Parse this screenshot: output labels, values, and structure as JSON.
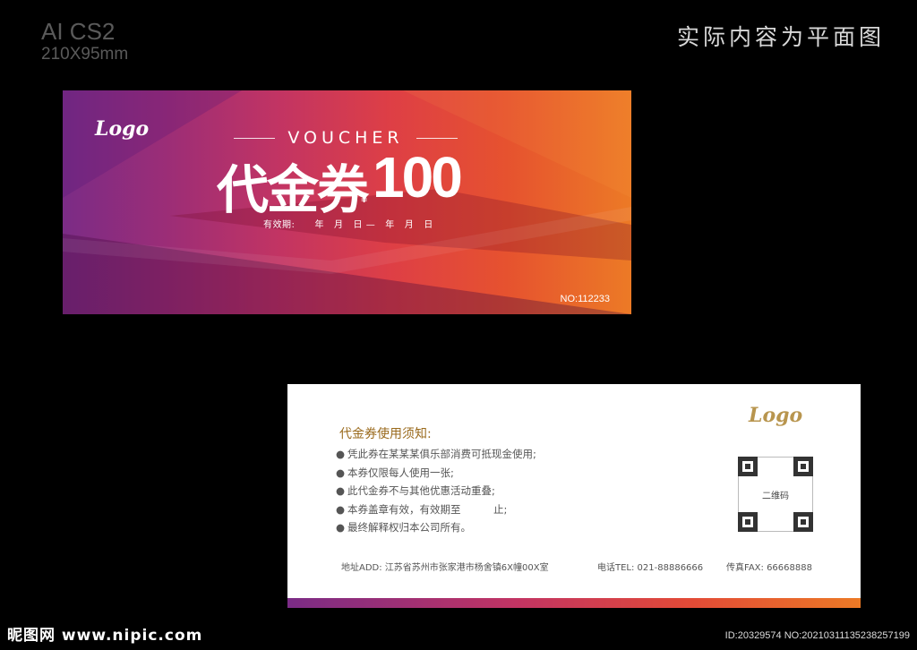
{
  "meta": {
    "software": "AI CS2",
    "size": "210X95mm",
    "note": "实际内容为平面图"
  },
  "front": {
    "logo": "Logo",
    "voucher_word": "VOUCHER",
    "title": "代金券",
    "currency": "¥",
    "amount": "100",
    "validity": "有效期:      年   月   日 —   年   月   日",
    "serial": "NO:112233",
    "colors": {
      "gradient_start": "#7b2c86",
      "gradient_mid": "#de3f45",
      "gradient_end": "#ec7a26"
    }
  },
  "back": {
    "logo": "Logo",
    "notes_title": "代金券使用须知:",
    "notes": [
      "凭此券在某某某俱乐部消费可抵现金使用;",
      "本券仅限每人使用一张;",
      "此代金券不与其他优惠活动重叠;",
      "本券盖章有效，有效期至          止;",
      "最终解释权归本公司所有。"
    ],
    "qr_label": "二维码",
    "address": "地址ADD: 江苏省苏州市张家港市杨舍镇6X幢00X室",
    "phone": "电话TEL: 021-88886666",
    "fax": "传真FAX: 66668888",
    "colors": {
      "title": "#9a6a1c",
      "logo": "#b8954e"
    }
  },
  "watermark": {
    "site": "昵图网 www.nipic.com",
    "id": "ID:20329574 NO:20210311135238257199"
  }
}
